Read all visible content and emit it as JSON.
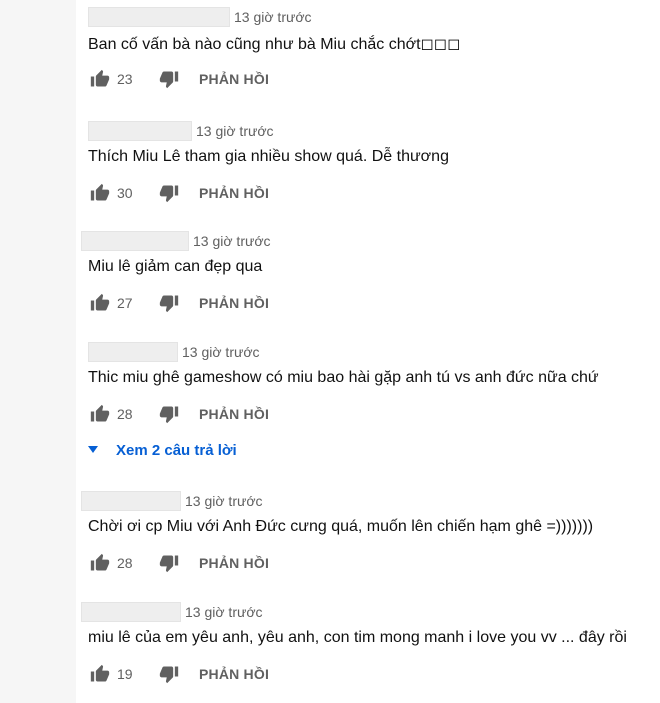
{
  "comments": [
    {
      "timestamp": "13 giờ trước",
      "text": "Ban cố vấn bà nào cũng như bà Miu chắc chớt◻◻◻",
      "likes": "23",
      "reply_label": "PHẢN HỒI"
    },
    {
      "timestamp": "13 giờ trước",
      "text": "Thích Miu Lê tham gia nhiều show quá. Dễ thương",
      "likes": "30",
      "reply_label": "PHẢN HỒI"
    },
    {
      "timestamp": "13 giờ trước",
      "text": "Miu lê giảm can đẹp qua",
      "likes": "27",
      "reply_label": "PHẢN HỒI"
    },
    {
      "timestamp": "13 giờ trước",
      "text": "Thic miu ghê gameshow có miu bao hài gặp anh tú vs anh đức nữa chứ",
      "likes": "28",
      "reply_label": "PHẢN HỒI"
    },
    {
      "timestamp": "13 giờ trước",
      "text": "Chời ơi cp Miu với Anh Đức cưng quá, muốn lên chiến hạm ghê =)))))))",
      "likes": "28",
      "reply_label": "PHẢN HỒI"
    },
    {
      "timestamp": "13 giờ trước",
      "text": "miu lê của em yêu anh, yêu anh, con tim mong manh  i love you vv ... đây rồi",
      "likes": "19",
      "reply_label": "PHẢN HỒI"
    }
  ],
  "view_replies_label": "Xem 2 câu trả lời",
  "colors": {
    "accent": "#065fd4",
    "text": "#111111",
    "muted": "#606060"
  }
}
